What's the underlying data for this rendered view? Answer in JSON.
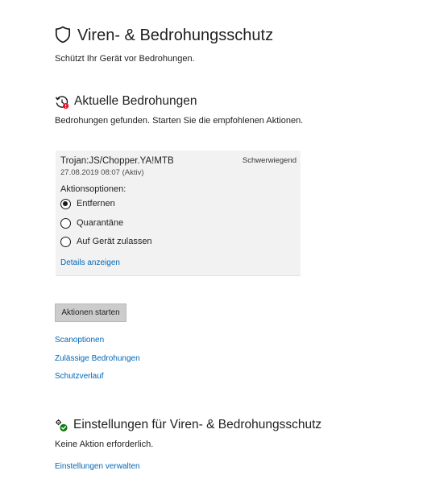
{
  "page": {
    "title": "Viren- & Bedrohungsschutz",
    "subtitle": "Schützt Ihr Gerät vor Bedrohungen.",
    "icon": "shield-icon"
  },
  "current_threats": {
    "title": "Aktuelle Bedrohungen",
    "icon": "threat-history-icon",
    "description": "Bedrohungen gefunden. Starten Sie die empfohlenen Aktionen.",
    "threat": {
      "name": "Trojan:JS/Chopper.YA!MTB",
      "date": "27.08.2019 08:07 (Aktiv)",
      "severity": "Schwerwiegend",
      "options_label": "Aktionsoptionen:",
      "options": [
        {
          "label": "Entfernen",
          "selected": true
        },
        {
          "label": "Quarantäne",
          "selected": false
        },
        {
          "label": "Auf Gerät zulassen",
          "selected": false
        }
      ],
      "details_link": "Details anzeigen"
    },
    "start_button": "Aktionen starten",
    "links": [
      "Scanoptionen",
      "Zulässige Bedrohungen",
      "Schutzverlauf"
    ]
  },
  "settings": {
    "title": "Einstellungen für Viren- & Bedrohungsschutz",
    "icon": "settings-gear-icon",
    "description": "Keine Aktion erforderlich.",
    "manage_link": "Einstellungen verwalten"
  },
  "colors": {
    "link": "#0067b8",
    "card_background": "#f2f2f2",
    "button_background": "#cccccc",
    "alert_red": "#e81123",
    "ok_green": "#107c10"
  }
}
